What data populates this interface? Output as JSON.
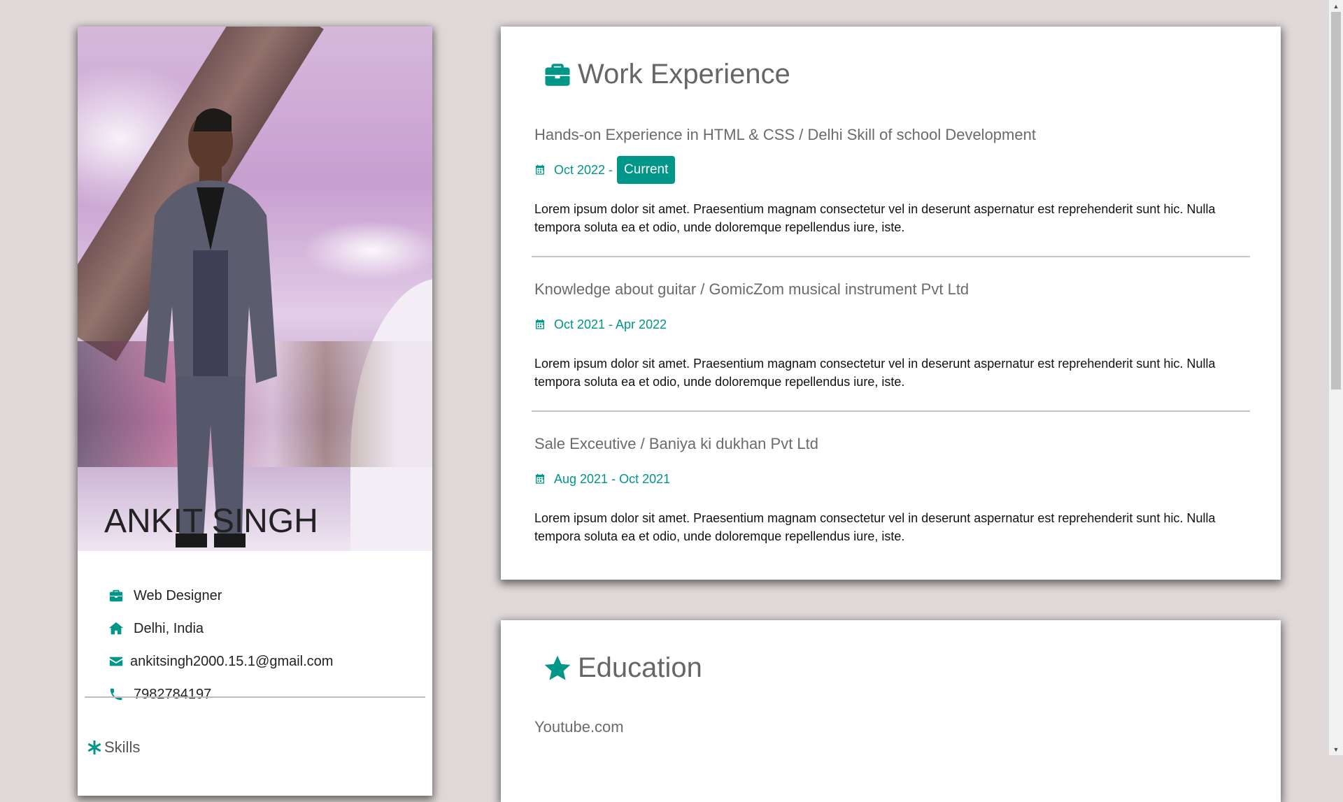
{
  "profile": {
    "name": "ANKIT SINGH",
    "photo_alt": "Profile photo",
    "job": "Web Designer",
    "location": "Delhi, India",
    "email": "ankitsingh2000.15.1@gmail.com",
    "phone": "7982784197",
    "skills_heading": "Skills"
  },
  "work": {
    "title": "Work Experience",
    "jobs": [
      {
        "title": "Hands-on Experience in HTML & CSS / Delhi Skill of school Development",
        "date": "Oct 2022 -",
        "badge": "Current",
        "description": "Lorem ipsum dolor sit amet. Praesentium magnam consectetur vel in deserunt aspernatur est reprehenderit sunt hic. Nulla tempora soluta ea et odio, unde doloremque repellendus iure, iste."
      },
      {
        "title": "Knowledge about guitar / GomicZom musical instrument Pvt Ltd",
        "date": "Oct 2021 - Apr 2022",
        "description": "Lorem ipsum dolor sit amet. Praesentium magnam consectetur vel in deserunt aspernatur est reprehenderit sunt hic. Nulla tempora soluta ea et odio, unde doloremque repellendus iure, iste."
      },
      {
        "title": "Sale Exceutive / Baniya ki dukhan Pvt Ltd",
        "date": "Aug 2021 - Oct 2021",
        "description": "Lorem ipsum dolor sit amet. Praesentium magnam consectetur vel in deserunt aspernatur est reprehenderit sunt hic. Nulla tempora soluta ea et odio, unde doloremque repellendus iure, iste."
      }
    ]
  },
  "education": {
    "title": "Education",
    "first_item": "Youtube.com"
  },
  "colors": {
    "accent": "#009688",
    "page_background": "#e0d9d9",
    "card_background": "#ffffff"
  },
  "icons": [
    "briefcase-icon",
    "home-icon",
    "envelope-icon",
    "phone-icon",
    "asterisk-icon",
    "calendar-icon",
    "star-icon"
  ],
  "scrollbar": {
    "up": "▲",
    "down": "▼"
  }
}
